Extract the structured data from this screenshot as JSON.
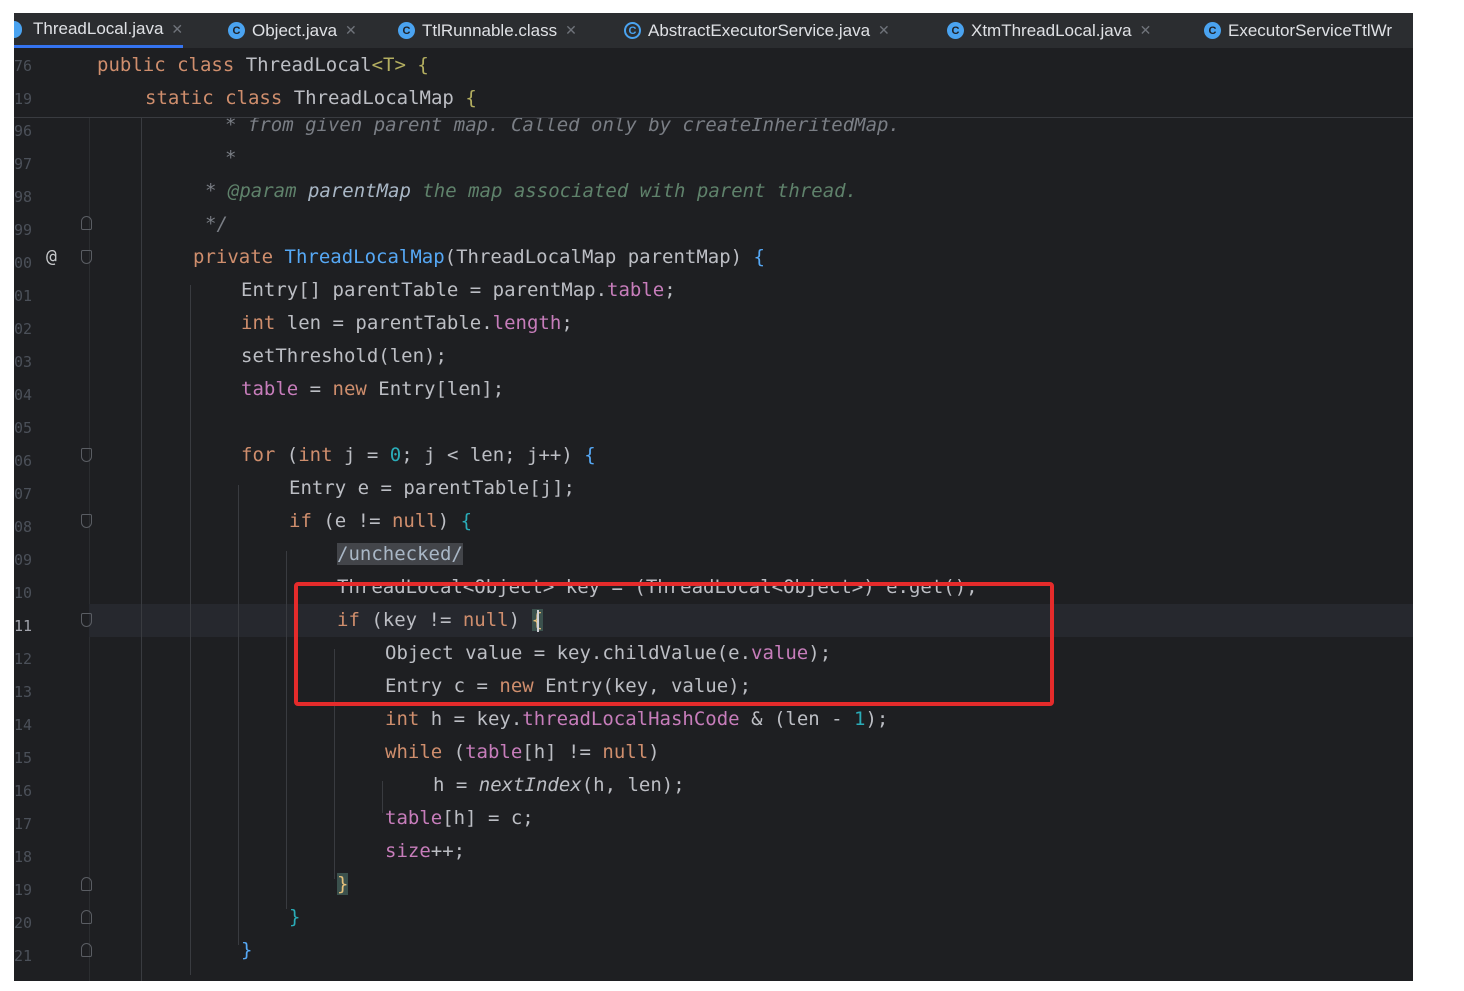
{
  "tabs": [
    {
      "label": "ThreadLocal.java",
      "active": true,
      "icon": "java-class-icon"
    },
    {
      "label": "Object.java",
      "active": false,
      "icon": "java-class-icon"
    },
    {
      "label": "TtlRunnable.class",
      "active": false,
      "icon": "java-class-icon"
    },
    {
      "label": "AbstractExecutorService.java",
      "active": false,
      "icon": "abstract-class-icon"
    },
    {
      "label": "XtmThreadLocal.java",
      "active": false,
      "icon": "java-class-icon"
    },
    {
      "label": "ExecutorServiceTtlWr",
      "active": false,
      "icon": "java-class-icon"
    }
  ],
  "sticky": {
    "line1": {
      "ln": "76",
      "kw": "public class ",
      "name": "ThreadLocal",
      "gen": "<T>",
      "rest": " {"
    },
    "line2": {
      "ln": "19",
      "kw": "static class ",
      "name": "ThreadLocalMap",
      "rest": " {"
    }
  },
  "lines": {
    "l96": {
      "ln": "96",
      "text": "* from given parent map. Called only by createInheritedMap."
    },
    "l97": {
      "ln": "97",
      "text": "*"
    },
    "l98": {
      "ln": "98",
      "star": "* ",
      "tag": "@param",
      "param": " parentMap",
      "rest": " the map associated with parent thread."
    },
    "l99": {
      "ln": "99",
      "text": "*/"
    },
    "l100": {
      "ln": "00",
      "kw": "private ",
      "fn": "ThreadLocalMap",
      "rest": "(ThreadLocalMap parentMap) ",
      "br": "{"
    },
    "l101": {
      "ln": "01",
      "a": "Entry[] parentTable = parentMap.",
      "f": "table",
      "b": ";"
    },
    "l102": {
      "ln": "02",
      "kw": "int",
      "a": " len = parentTable.",
      "f": "length",
      "b": ";"
    },
    "l103": {
      "ln": "03",
      "a": "setThreshold(len);"
    },
    "l104": {
      "ln": "04",
      "f": "table",
      "a": " = ",
      "kw": "new",
      "b": " Entry[len];"
    },
    "l105": {
      "ln": "05"
    },
    "l106": {
      "ln": "06",
      "kw": "for",
      "a": " (",
      "kw2": "int",
      "b": " j = ",
      "num": "0",
      "c": "; j < len; j++) ",
      "br": "{"
    },
    "l107": {
      "ln": "07",
      "a": "Entry e = parentTable[j];"
    },
    "l108": {
      "ln": "08",
      "kw": "if",
      "a": " (e != ",
      "kw2": "null",
      "b": ") ",
      "br": "{"
    },
    "l109": {
      "ln": "09",
      "supp": "/unchecked/"
    },
    "l110": {
      "ln": "10",
      "text": "ThreadLocal<Object> key = (ThreadLocal<Object>) e.get();"
    },
    "l111": {
      "ln": "11",
      "kw": "if",
      "a": " (key != ",
      "kw2": "null",
      "b": ") ",
      "br": "{"
    },
    "l112": {
      "ln": "12",
      "a": "Object value = key.childValue(e.",
      "f": "value",
      "b": ");"
    },
    "l113": {
      "ln": "13",
      "a": "Entry c = ",
      "kw": "new",
      "b": " Entry(key, value);"
    },
    "l114": {
      "ln": "14",
      "kw": "int",
      "a": " h = key.",
      "f": "threadLocalHashCode",
      "b": " & (len - ",
      "num": "1",
      "c": ");"
    },
    "l115": {
      "ln": "15",
      "kw": "while",
      "a": " (",
      "f": "table",
      "b": "[h] != ",
      "kw2": "null",
      "c": ")"
    },
    "l116": {
      "ln": "16",
      "a": "h = ",
      "it": "nextIndex",
      "b": "(h, len);"
    },
    "l117": {
      "ln": "17",
      "f": "table",
      "a": "[h] = c;"
    },
    "l118": {
      "ln": "18",
      "f": "size",
      "a": "++;"
    },
    "l119": {
      "ln": "19",
      "br": "}"
    },
    "l120": {
      "ln": "20",
      "br": "}"
    },
    "l121": {
      "ln": "21",
      "br": "}"
    }
  },
  "gutter_marker": "@",
  "colors": {
    "highlight_box": "#e52b2b",
    "editor_bg": "#1e1f22",
    "keyword": "#cf8e6d",
    "function": "#56a8f5",
    "field": "#c77dbb",
    "number": "#2aacb8"
  }
}
